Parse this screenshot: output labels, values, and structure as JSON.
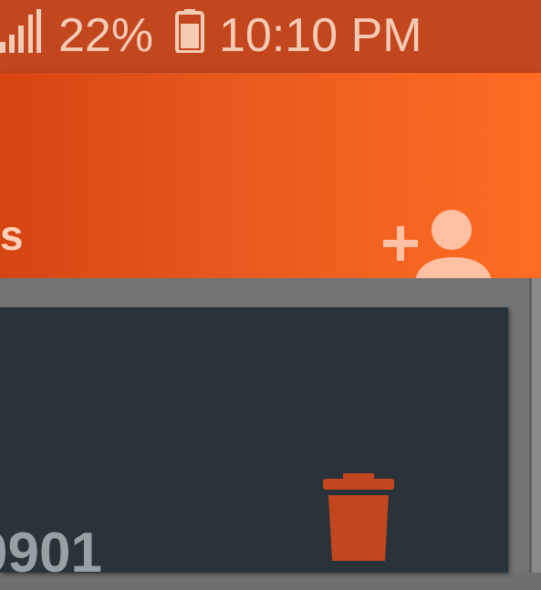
{
  "status_bar": {
    "signal_icon": "signal-bars-icon",
    "battery_percent": "22%",
    "battery_icon": "battery-icon",
    "time": "10:10 PM"
  },
  "app_bar": {
    "title": "s",
    "add_contact_icon": "add-person-icon"
  },
  "contact_card": {
    "number": "0901",
    "delete_icon": "trash-icon"
  },
  "colors": {
    "status_bar": "#c2461e",
    "app_bar_start": "#d64512",
    "app_bar_end": "#ff6c22",
    "card_bg": "#2a3339",
    "icon_light": "#ffc0a4",
    "delete_icon": "#c2461e"
  }
}
